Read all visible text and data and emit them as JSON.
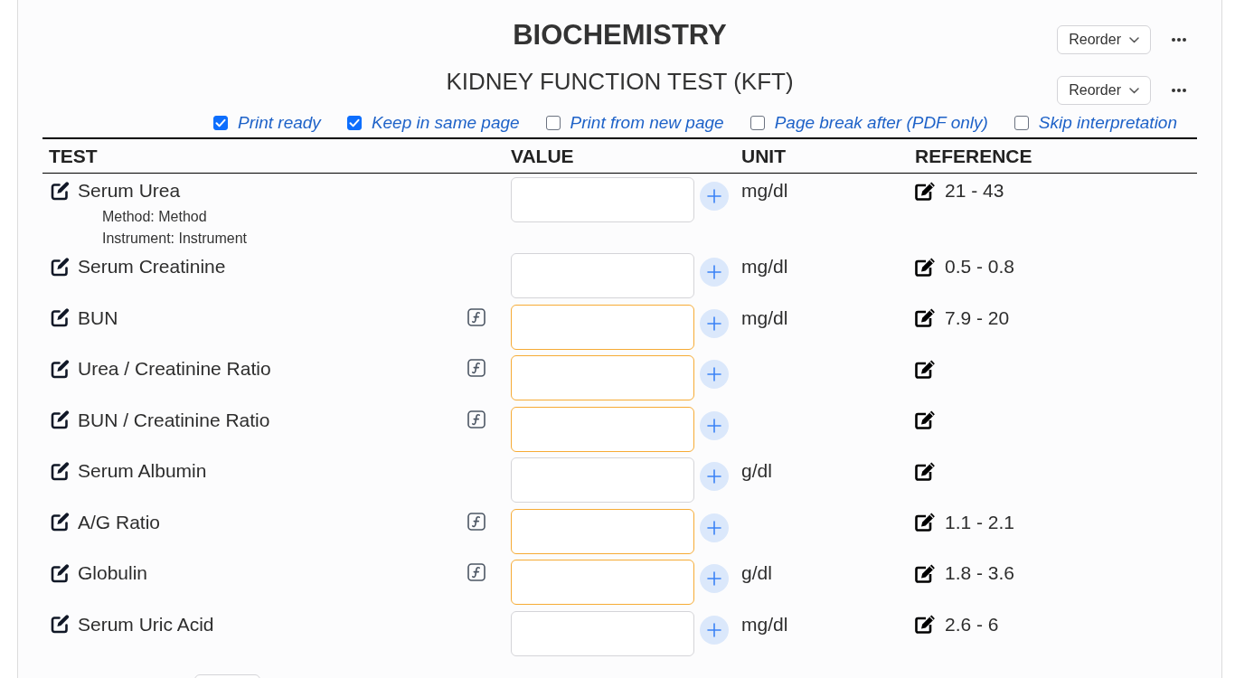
{
  "header": {
    "title": "BIOCHEMISTRY",
    "reorder_button": "Reorder"
  },
  "group": {
    "title": "KIDNEY FUNCTION TEST (KFT)",
    "reorder_button": "Reorder",
    "options": [
      {
        "label": "Print ready",
        "checked": true
      },
      {
        "label": "Keep in same page",
        "checked": true
      },
      {
        "label": "Print from new page",
        "checked": false
      },
      {
        "label": "Page break after (PDF only)",
        "checked": false
      },
      {
        "label": "Skip interpretation",
        "checked": false
      }
    ],
    "table": {
      "columns": [
        "TEST",
        "VALUE",
        "UNIT",
        "REFERENCE"
      ],
      "rows": [
        {
          "test": "Serum Urea",
          "details": [
            "Method: Method",
            "Instrument: Instrument"
          ],
          "calculated": false,
          "unit": "mg/dl",
          "reference": "21 - 43"
        },
        {
          "test": "Serum Creatinine",
          "calculated": false,
          "unit": "mg/dl",
          "reference": "0.5 - 0.8"
        },
        {
          "test": "BUN",
          "calculated": true,
          "unit": "mg/dl",
          "reference": "7.9 - 20"
        },
        {
          "test": "Urea / Creatinine Ratio",
          "calculated": true
        },
        {
          "test": "BUN / Creatinine Ratio",
          "calculated": true
        },
        {
          "test": "Serum Albumin",
          "calculated": false,
          "unit": "g/dl"
        },
        {
          "test": "A/G Ratio",
          "calculated": true,
          "reference": "1.1 - 2.1"
        },
        {
          "test": "Globulin",
          "calculated": true,
          "unit": "g/dl",
          "reference": "1.8 - 3.6"
        },
        {
          "test": "Serum Uric Acid",
          "calculated": false,
          "unit": "mg/dl",
          "reference": "2.6 - 6"
        }
      ]
    }
  }
}
